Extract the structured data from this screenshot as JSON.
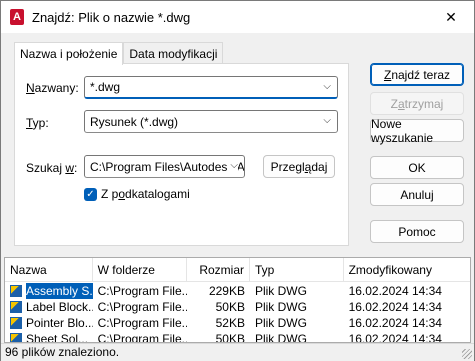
{
  "window": {
    "title": "Znajdź: Plik o nazwie *.dwg",
    "app_icon_letter": "A",
    "close_glyph": "✕"
  },
  "tabs": [
    {
      "label": "Nazwa i położenie"
    },
    {
      "label": "Data modyfikacji"
    }
  ],
  "form": {
    "name_label_u": "N",
    "name_label_rest": "azwany:",
    "name_value": "*.dwg",
    "type_label_u": "T",
    "type_label_rest": "yp:",
    "type_value": "Rysunek (*.dwg)",
    "lookin_label_pre": "Szukaj ",
    "lookin_label_u": "w",
    "lookin_label_post": ":",
    "lookin_value": "C:\\Program Files\\Autodesk\\A",
    "browse_pre": "Przegl",
    "browse_u": "ą",
    "browse_post": "daj",
    "subfolders_pre": "Z p",
    "subfolders_u": "o",
    "subfolders_post": "dkatalogami",
    "subfolders_checked": true
  },
  "buttons": {
    "find_now_pre": "",
    "find_now_u": "Z",
    "find_now_post": "najdź teraz",
    "stop_pre": "Z",
    "stop_u": "a",
    "stop_post": "trzymaj",
    "new_search": "Nowe wyszukanie",
    "ok": "OK",
    "cancel": "Anuluj",
    "help": "Pomoc"
  },
  "results": {
    "columns": [
      "Nazwa",
      "W folderze",
      "Rozmiar",
      "Typ",
      "Zmodyfikowany"
    ],
    "rows": [
      {
        "name": "Assembly S...",
        "folder": "C:\\Program File...",
        "size": "229KB",
        "type": "Plik DWG",
        "modified": "16.02.2024 14:34",
        "selected": true
      },
      {
        "name": "Label Block...",
        "folder": "C:\\Program File...",
        "size": "50KB",
        "type": "Plik DWG",
        "modified": "16.02.2024 14:34",
        "selected": false
      },
      {
        "name": "Pointer Blo...",
        "folder": "C:\\Program File...",
        "size": "52KB",
        "type": "Plik DWG",
        "modified": "16.02.2024 14:34",
        "selected": false
      },
      {
        "name": "Sheet Sol...",
        "folder": "C:\\Program File...",
        "size": "50KB",
        "type": "Plik DWG",
        "modified": "16.02.2024 14:34",
        "selected": false
      }
    ]
  },
  "status": "96 plików znaleziono.",
  "colors": {
    "accent": "#005fb8",
    "app_icon": "#c8102e"
  }
}
